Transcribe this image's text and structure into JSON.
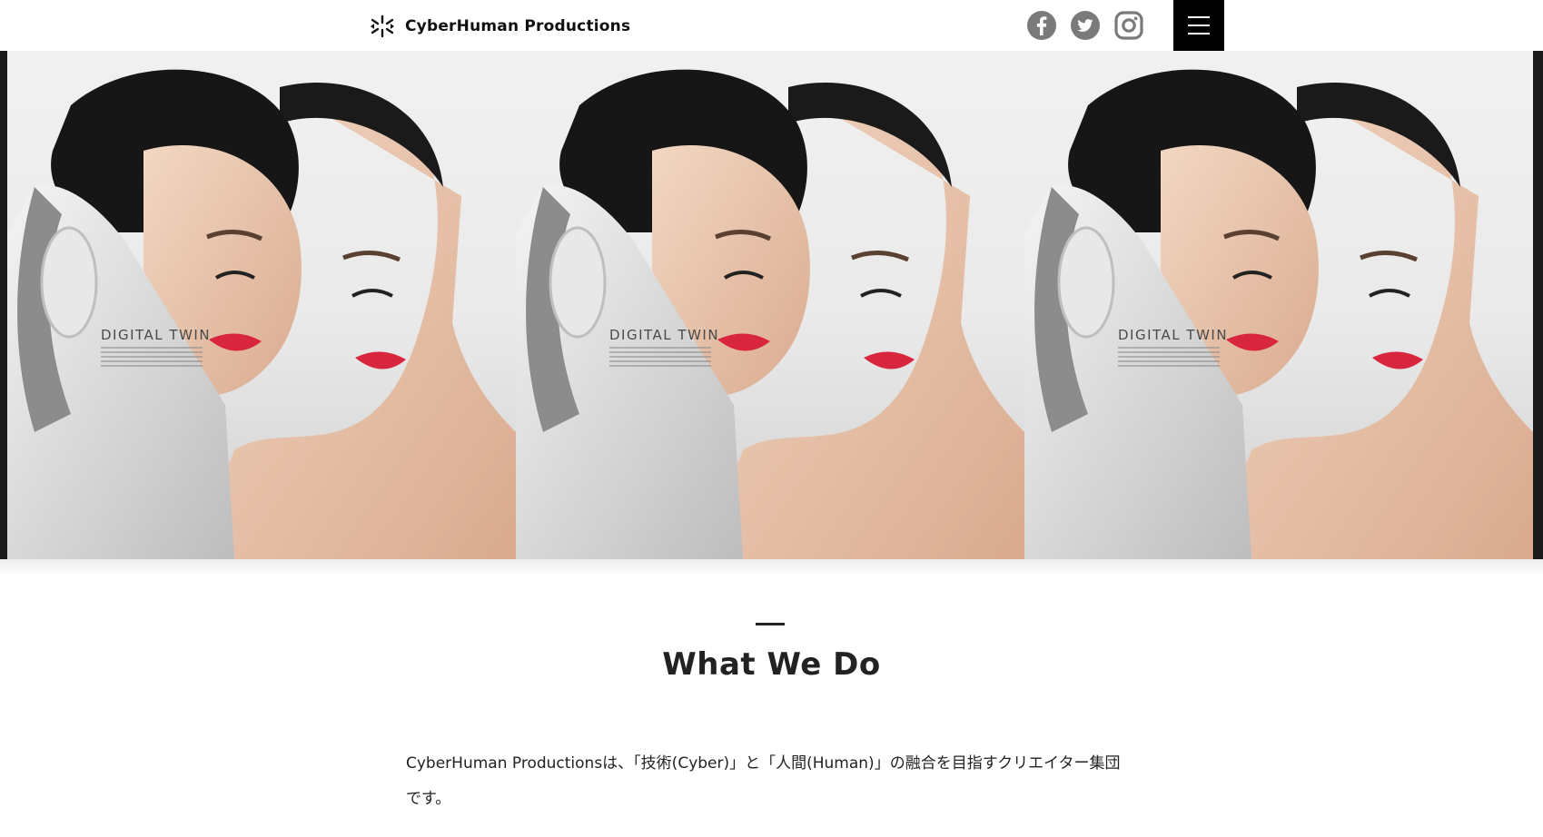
{
  "header": {
    "brand_name": "CyberHuman Productions",
    "brand_icon": "cyberhuman-logo-icon",
    "social": [
      {
        "name": "facebook",
        "icon": "facebook-icon"
      },
      {
        "name": "twitter",
        "icon": "twitter-icon"
      },
      {
        "name": "instagram",
        "icon": "instagram-icon"
      }
    ],
    "menu_icon": "hamburger-menu-icon",
    "social_color": "#7a7a7a",
    "menu_bg": "#000000"
  },
  "hero": {
    "panels": [
      {
        "caption": "DIGITAL TWIN"
      },
      {
        "caption": "DIGITAL TWIN"
      },
      {
        "caption": "DIGITAL TWIN"
      }
    ],
    "lip_color": "#d7263d"
  },
  "what_we_do": {
    "title": "What We Do",
    "body": "CyberHuman Productionsは、「技術(Cyber)」と「人間(Human)」の融合を目指すクリエイター集団です。"
  }
}
